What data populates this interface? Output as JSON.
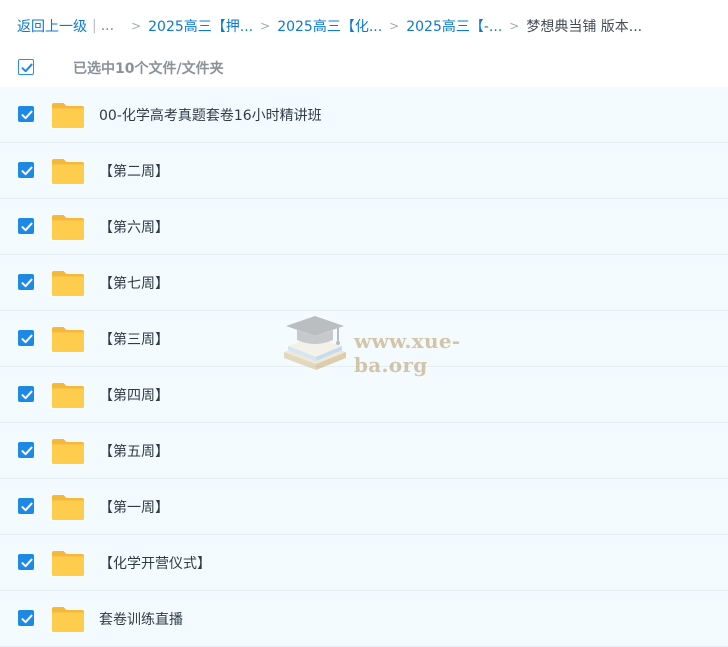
{
  "breadcrumb": {
    "back_label": "返回上一级",
    "pipe": "|",
    "ellipsis": "...",
    "separator": ">",
    "items": [
      "2025高三【押...",
      "2025高三【化...",
      "2025高三【-...",
      "梦想典当铺 版本..."
    ]
  },
  "selection": {
    "checked": true,
    "summary": "已选中10个文件/文件夹"
  },
  "files": [
    {
      "name": "00-化学高考真题套卷16小时精讲班",
      "type": "folder",
      "checked": true
    },
    {
      "name": "【第二周】",
      "type": "folder",
      "checked": true
    },
    {
      "name": "【第六周】",
      "type": "folder",
      "checked": true
    },
    {
      "name": "【第七周】",
      "type": "folder",
      "checked": true
    },
    {
      "name": "【第三周】",
      "type": "folder",
      "checked": true
    },
    {
      "name": "【第四周】",
      "type": "folder",
      "checked": true
    },
    {
      "name": "【第五周】",
      "type": "folder",
      "checked": true
    },
    {
      "name": "【第一周】",
      "type": "folder",
      "checked": true
    },
    {
      "name": "【化学开营仪式】",
      "type": "folder",
      "checked": true
    },
    {
      "name": "套卷训练直播",
      "type": "folder",
      "checked": true
    }
  ],
  "watermark": {
    "text": "www.xue-ba.org",
    "icon": "graduation-cap-icon"
  },
  "colors": {
    "link": "#0b7ad1",
    "checkbox": "#1e88e5",
    "row_bg": "#f4fbff",
    "folder": "#ffcb45"
  }
}
